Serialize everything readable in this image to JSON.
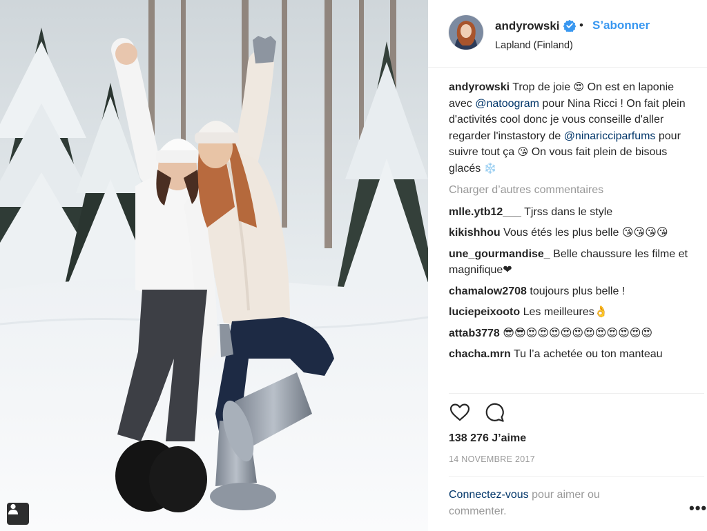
{
  "post": {
    "username": "andyrowski",
    "follow_label": "S’abonner",
    "dot": "•",
    "location": "Lapland (Finland)",
    "caption": {
      "username": "andyrowski",
      "parts": [
        {
          "t": "text",
          "v": " Trop de joie "
        },
        {
          "t": "emoji",
          "v": "😍"
        },
        {
          "t": "text",
          "v": " On est en laponie avec "
        },
        {
          "t": "mention",
          "v": "@natoogram"
        },
        {
          "t": "text",
          "v": " pour Nina Ricci ! On fait plein d'activités cool donc je vous conseille d'aller regarder l'instastory de "
        },
        {
          "t": "mention",
          "v": "@ninariccipar­fums"
        },
        {
          "t": "text",
          "v": " pour suivre tout ça "
        },
        {
          "t": "emoji",
          "v": "😘"
        },
        {
          "t": "text",
          "v": " On vous fait plein de bisous glacés "
        },
        {
          "t": "emoji",
          "v": "❄️"
        }
      ]
    },
    "load_more_label": "Charger d’autres commentaires",
    "comments": [
      {
        "user": "mlle.ytb12___",
        "text": " Tjrss dans le style"
      },
      {
        "user": "kikishhou",
        "text": " Vous étés les plus belle 😘😘😘😘"
      },
      {
        "user": "une_gourmandise_",
        "text": " Belle chaussure les filme et magnifique❤"
      },
      {
        "user": "chamalow2708",
        "text": " toujours plus belle !"
      },
      {
        "user": "luciepeixooto",
        "text": " Les meilleures👌"
      },
      {
        "user": "attab3778",
        "text": " 😎😎😍😍😍😍😍😍😍😍😍😍😍"
      },
      {
        "user": "chacha.mrn",
        "text": " Tu l’a achetée ou ton manteau"
      }
    ],
    "likes_label": "138 276 J’aime",
    "date_label": "14 NOVEMBRE 2017",
    "login": {
      "link_label": "Connectez-vous",
      "rest_label": " pour aimer ou commenter."
    },
    "more_label": "•••"
  },
  "icons": {
    "like": "heart-outline-icon",
    "comment": "speech-bubble-icon",
    "verified": "verified-badge-icon",
    "user_tag": "person-tag-icon",
    "more": "more-options-icon"
  },
  "colors": {
    "accent": "#3897f0",
    "mention": "#003569",
    "muted": "#999999",
    "divider": "#efefef"
  }
}
